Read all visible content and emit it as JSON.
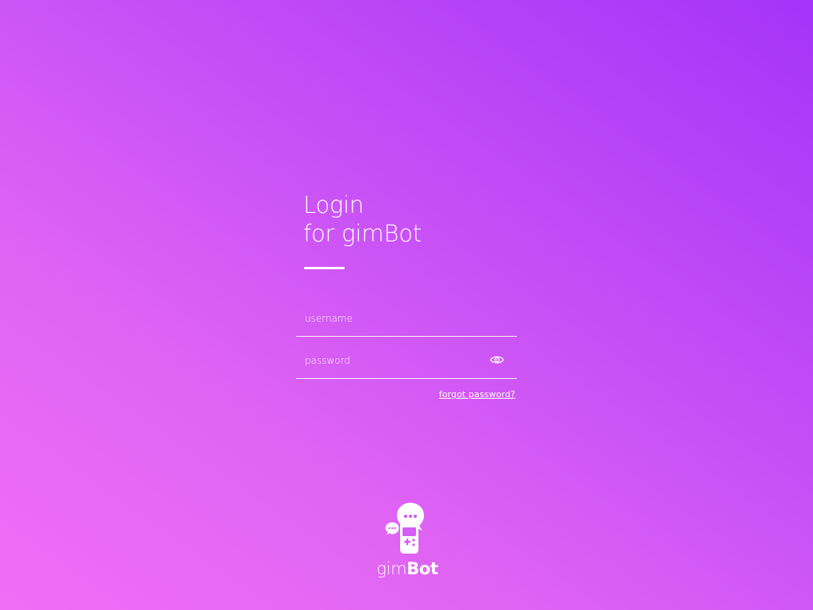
{
  "login": {
    "title_line1": "Login",
    "title_line2": "for gimBot",
    "username_placeholder": "username",
    "password_placeholder": "password",
    "forgot_link": "forgot password?"
  },
  "brand": {
    "name_light": "gim",
    "name_bold": "Bot",
    "logo_icon": "gamepad-chat-icon"
  },
  "colors": {
    "gradient_start": "#ef6ef6",
    "gradient_end": "#a533f8",
    "text": "#ffffff"
  }
}
